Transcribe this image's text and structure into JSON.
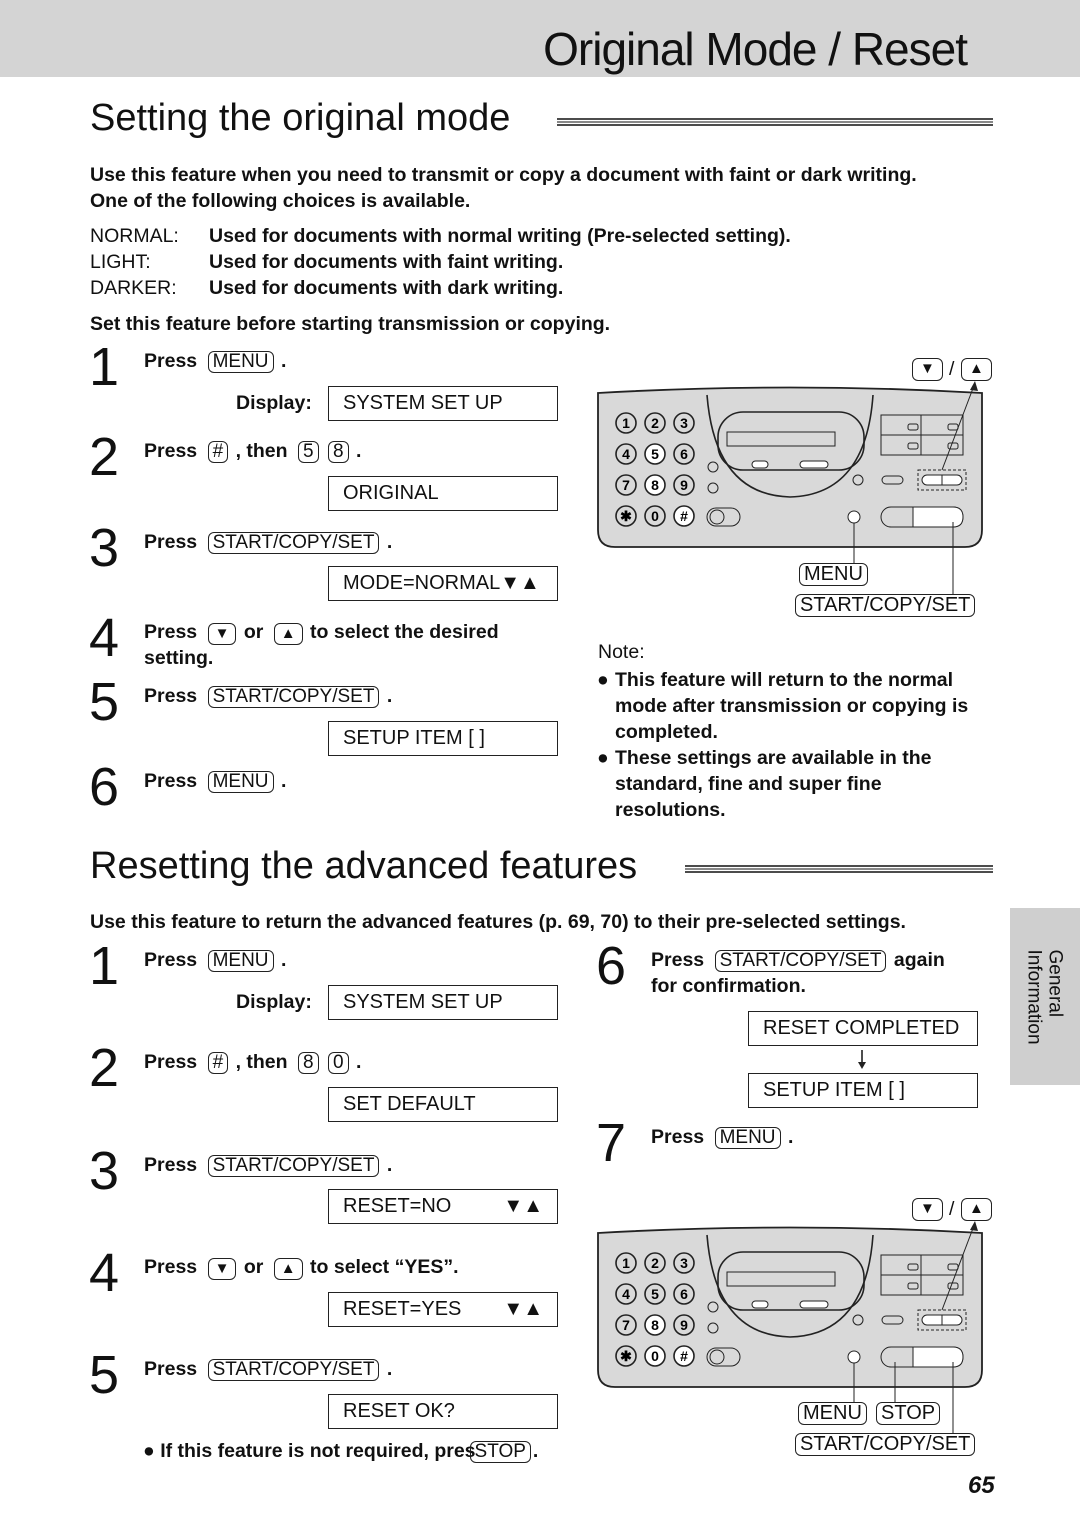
{
  "header": {
    "title": "Original Mode / Reset"
  },
  "s1": {
    "heading": "Setting the original mode",
    "intro1": "Use this feature when you need to transmit or copy a document with faint or dark writing.",
    "intro2": "One of the following choices is available.",
    "options": [
      {
        "label": "NORMAL:",
        "desc": "Used for documents with normal writing (Pre-selected setting)."
      },
      {
        "label": "LIGHT:",
        "desc": "Used for documents with faint writing."
      },
      {
        "label": "DARKER:",
        "desc": "Used for documents with dark writing."
      }
    ],
    "before": "Set this feature before starting transmission or copying.",
    "display_label": "Display:",
    "steps": [
      {
        "n": "1",
        "parts": [
          {
            "t": "Press"
          },
          {
            "k": "MENU"
          },
          {
            "t": "."
          }
        ]
      },
      {
        "n": "2",
        "parts": [
          {
            "t": "Press"
          },
          {
            "k": "#"
          },
          {
            "t": ", then"
          },
          {
            "k": "5"
          },
          {
            "k": "8"
          },
          {
            "t": "."
          }
        ]
      },
      {
        "n": "3",
        "parts": [
          {
            "t": "Press"
          },
          {
            "k": "START/COPY/SET"
          },
          {
            "t": "."
          }
        ]
      },
      {
        "n": "4",
        "parts": [
          {
            "t": "Press"
          },
          {
            "i": "down-arrow"
          },
          {
            "t": "or"
          },
          {
            "i": "up-arrow"
          },
          {
            "t": "to select the desired"
          }
        ],
        "line2": "setting."
      },
      {
        "n": "5",
        "parts": [
          {
            "t": "Press"
          },
          {
            "k": "START/COPY/SET"
          },
          {
            "t": "."
          }
        ]
      },
      {
        "n": "6",
        "parts": [
          {
            "t": "Press"
          },
          {
            "k": "MENU"
          },
          {
            "t": "."
          }
        ]
      }
    ],
    "displays": [
      "SYSTEM SET UP",
      "ORIGINAL",
      "MODE=NORMAL▼▲",
      "SETUP ITEM [  ]"
    ],
    "note_title": "Note:",
    "notes": [
      [
        "This feature will return to the normal",
        "mode after transmission or copying is",
        "completed."
      ],
      [
        "These settings are available in the",
        "standard, fine and super fine",
        "resolutions."
      ]
    ],
    "diagram": {
      "menu": "MENU",
      "start": "START/COPY/SET",
      "highlight": [
        "5",
        "8",
        "#"
      ]
    }
  },
  "s2": {
    "heading": "Resetting the advanced features",
    "intro": "Use this feature to return the advanced features (p. 69, 70) to their pre-selected settings.",
    "display_label": "Display:",
    "steps": [
      {
        "n": "1",
        "parts": [
          {
            "t": "Press"
          },
          {
            "k": "MENU"
          },
          {
            "t": "."
          }
        ]
      },
      {
        "n": "2",
        "parts": [
          {
            "t": "Press"
          },
          {
            "k": "#"
          },
          {
            "t": ", then"
          },
          {
            "k": "8"
          },
          {
            "k": "0"
          },
          {
            "t": "."
          }
        ]
      },
      {
        "n": "3",
        "parts": [
          {
            "t": "Press"
          },
          {
            "k": "START/COPY/SET"
          },
          {
            "t": "."
          }
        ]
      },
      {
        "n": "4",
        "parts": [
          {
            "t": "Press"
          },
          {
            "i": "down-arrow"
          },
          {
            "t": "or"
          },
          {
            "i": "up-arrow"
          },
          {
            "t": "to select “YES”."
          }
        ]
      },
      {
        "n": "5",
        "parts": [
          {
            "t": "Press"
          },
          {
            "k": "START/COPY/SET"
          },
          {
            "t": "."
          }
        ]
      },
      {
        "n": "6",
        "parts": [
          {
            "t": "Press"
          },
          {
            "k": "START/COPY/SET"
          },
          {
            "t": "again"
          }
        ],
        "line2": "for confirmation."
      },
      {
        "n": "7",
        "parts": [
          {
            "t": "Press"
          },
          {
            "k": "MENU"
          },
          {
            "t": "."
          }
        ]
      }
    ],
    "displays": [
      "SYSTEM SET UP",
      "SET DEFAULT",
      "RESET=NO",
      "RESET=YES",
      "RESET OK?",
      "RESET COMPLETED",
      "SETUP ITEM [  ]"
    ],
    "display_arrows": "▼▲",
    "stop_note": {
      "t": "If this feature is not required, pres",
      "k": "STOP",
      "post": "."
    },
    "diagram": {
      "menu": "MENU",
      "stop": "STOP",
      "start": "START/COPY/SET",
      "highlight": [
        "8",
        "0",
        "#"
      ]
    }
  },
  "side_tab": {
    "line1": "General",
    "line2": "Information"
  },
  "page_number": "65"
}
